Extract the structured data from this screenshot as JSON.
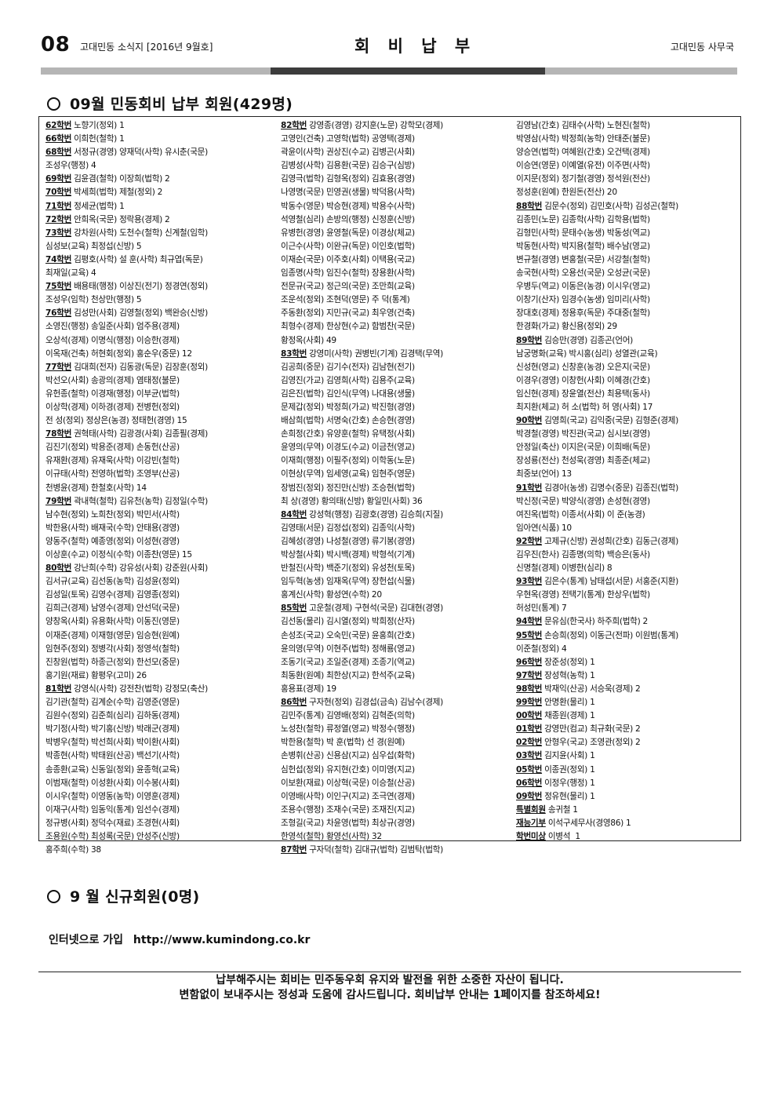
{
  "header": {
    "page_number": "08",
    "issue": "고대민동 소식지 [2016년  9월호]",
    "title": "회 비 납 부",
    "org": "고대민동 사무국"
  },
  "section1": {
    "title": "09월 민동회비 납부 회원(429명)"
  },
  "columns": [
    [
      {
        "lead": "62학번",
        "text": " 노향기(정외) 1"
      },
      {
        "lead": "66학번",
        "text": " 이희헌(철학) 1"
      },
      {
        "lead": "68학번",
        "text": " 서정규(경영) 양재덕(사학) 유시춘(국문)"
      },
      {
        "lead": "",
        "text": "조성우(행정) 4"
      },
      {
        "lead": "69학번",
        "text": " 김윤겸(철학) 이장희(법학) 2"
      },
      {
        "lead": "70학번",
        "text": " 박세희(법학) 제철(정외) 2"
      },
      {
        "lead": "71학번",
        "text": " 정세균(법학) 1"
      },
      {
        "lead": "72학번",
        "text": " 안희옥(국문) 정락용(경제) 2"
      },
      {
        "lead": "73학번",
        "text": " 강차원(사학) 도천수(철학) 신계철(임학)"
      },
      {
        "lead": "",
        "text": "심성보(교육) 최정섭(신방) 5"
      },
      {
        "lead": "74학번",
        "text": " 김평호(사학) 설 훈(사학) 최규엽(독문)"
      },
      {
        "lead": "",
        "text": "최재일(교육) 4"
      },
      {
        "lead": "75학번",
        "text": " 배용태(행정) 이상진(전기) 정경연(정외)"
      },
      {
        "lead": "",
        "text": "조성우(임학) 천상만(행정) 5"
      },
      {
        "lead": "76학번",
        "text": " 김성만(사회) 김영철(정외) 백완승(신방)"
      },
      {
        "lead": "",
        "text": "소영진(행정) 송일준(사회) 엄주용(경제)"
      },
      {
        "lead": "",
        "text": "오상석(경제) 이명식(행정) 이승한(경제)"
      },
      {
        "lead": "",
        "text": "이옥재(건축) 허현회(정외) 홍순우(중문) 12"
      },
      {
        "lead": "77학번",
        "text": " 김대희(전자) 김동광(독문) 김장훈(정외)"
      },
      {
        "lead": "",
        "text": "박선오(사회) 송광의(경제) 염태정(불문)"
      },
      {
        "lead": "",
        "text": "유헌종(철학) 이경재(행정) 이부균(법학)"
      },
      {
        "lead": "",
        "text": "이상학(경제) 이하경(경제) 전병헌(정외)"
      },
      {
        "lead": "",
        "text": "전 성(정외) 정상은(농경) 정태헌(경영) 15"
      },
      {
        "lead": "78학번",
        "text": " 권혁태(사학) 김광경(사회) 김종필(경제)"
      },
      {
        "lead": "",
        "text": "김진기(정외) 박용준(경제) 손동헌(산공)"
      },
      {
        "lead": "",
        "text": "유재환(경제) 유재욱(사학) 이강빈(철학)"
      },
      {
        "lead": "",
        "text": "이규태(사학) 전영하(법학) 조영부(산공)"
      },
      {
        "lead": "",
        "text": "천병윤(경제) 한철호(사학) 14"
      },
      {
        "lead": "79학번",
        "text": " 곽내혁(철학) 김유천(농학) 김정일(수학)"
      },
      {
        "lead": "",
        "text": "남수현(정외) 노희찬(정외) 박민서(사학)"
      },
      {
        "lead": "",
        "text": "박한용(사학) 배재국(수학) 안태용(경영)"
      },
      {
        "lead": "",
        "text": "양동주(철학) 예종영(정외) 이성현(경영)"
      },
      {
        "lead": "",
        "text": "이상훈(수교) 이정식(수학) 이종찬(영문) 15"
      },
      {
        "lead": "80학번",
        "text": " 강난희(수학) 강유성(사회) 강준원(사회)"
      },
      {
        "lead": "",
        "text": "김서규(교육) 김선동(농학) 김성윤(정외)"
      },
      {
        "lead": "",
        "text": "김성일(토목) 김영수(경제) 김영종(정외)"
      },
      {
        "lead": "",
        "text": "김희근(경제) 남영수(경제) 안선덕(국문)"
      },
      {
        "lead": "",
        "text": "양창옥(사회) 유용화(사학) 이동진(영문)"
      },
      {
        "lead": "",
        "text": "이재준(경제) 이재형(영문) 임승현(원예)"
      },
      {
        "lead": "",
        "text": "임현주(정외) 정병각(사회) 정영석(철학)"
      },
      {
        "lead": "",
        "text": "진창원(법학) 하종근(정외) 한선모(중문)"
      },
      {
        "lead": "",
        "text": "홍기원(재료) 황평우(고미) 26"
      },
      {
        "lead": "81학번",
        "text": " 강영식(사학) 강전찬(법학) 강정모(축산)"
      },
      {
        "lead": "",
        "text": "김기관(철학) 김계순(수학) 김영준(영문)"
      },
      {
        "lead": "",
        "text": "김원수(정외) 김준희(심리) 김하동(경제)"
      },
      {
        "lead": "",
        "text": "박기정(사학) 박기홍(신방) 박래군(경제)"
      },
      {
        "lead": "",
        "text": "박병우(철학) 박선희(사회) 박이환(사회)"
      },
      {
        "lead": "",
        "text": "박종현(사학) 박태원(산공) 백선기(사학)"
      },
      {
        "lead": "",
        "text": "송종환(교육) 신동일(정외) 윤종혁(교육)"
      },
      {
        "lead": "",
        "text": "이범재(철학) 이성환(사회) 이수봉(사회)"
      },
      {
        "lead": "",
        "text": "이시우(철학) 이영동(농학) 이영훈(경제)"
      },
      {
        "lead": "",
        "text": "이재구(사학) 임동익(통계) 임선수(경제)"
      },
      {
        "lead": "",
        "text": "정규병(사회) 정덕수(재료) 조경현(사회)"
      },
      {
        "lead": "",
        "text": "조용원(수학) 최성록(국문) 안성주(신방)"
      },
      {
        "lead": "",
        "text": "홍주희(수학) 38"
      }
    ],
    [
      {
        "lead": "82학번",
        "text": " 강영종(경영) 강지훈(노문) 강학모(경제)"
      },
      {
        "lead": "",
        "text": "고영인(건축) 고영학(법학) 공영택(경제)"
      },
      {
        "lead": "",
        "text": "곽윤이(사학) 권상진(수교) 김병곤(사회)"
      },
      {
        "lead": "",
        "text": "김병성(사학) 김용환(국문) 김승구(심방)"
      },
      {
        "lead": "",
        "text": "김영극(법학) 김형옥(정외) 김효용(경영)"
      },
      {
        "lead": "",
        "text": "나영명(국문) 민영권(생물) 박덕용(사학)"
      },
      {
        "lead": "",
        "text": "박동수(영문) 박승현(경제) 박용수(사학)"
      },
      {
        "lead": "",
        "text": "석영철(심리) 손방의(행정) 신정훈(신방)"
      },
      {
        "lead": "",
        "text": "유병헌(경영) 윤영철(독문) 이경상(체교)"
      },
      {
        "lead": "",
        "text": "이근수(사학) 이완규(독문) 이인호(법학)"
      },
      {
        "lead": "",
        "text": "이재순(국문) 이주호(사회) 이택용(국교)"
      },
      {
        "lead": "",
        "text": "임종명(사학) 임진수(철학) 장용환(사학)"
      },
      {
        "lead": "",
        "text": "전문규(국교) 정근의(국문) 조만희(교육)"
      },
      {
        "lead": "",
        "text": "조운석(정외) 조현덕(영문) 주 덕(통계)"
      },
      {
        "lead": "",
        "text": "주동환(정외) 지민규(국교) 최우영(건축)"
      },
      {
        "lead": "",
        "text": "최형수(경제) 한상현(수교) 함범찬(국문)"
      },
      {
        "lead": "",
        "text": "황정옥(사회) 49"
      },
      {
        "lead": "83학번",
        "text": " 강영미(사학) 권병빈(기계) 김경택(무역)"
      },
      {
        "lead": "",
        "text": "김공희(중문) 김기수(전자) 김남현(전기)"
      },
      {
        "lead": "",
        "text": "김영진(가교) 김영희(사학) 김용주(교육)"
      },
      {
        "lead": "",
        "text": "김은진(법학) 김인식(무역) 나대용(생물)"
      },
      {
        "lead": "",
        "text": "문제갑(정외) 박정희(가교) 박진형(경영)"
      },
      {
        "lead": "",
        "text": "배삼희(법학) 서명숙(간호) 손승현(경영)"
      },
      {
        "lead": "",
        "text": "손희정(간호) 유양훈(철학) 유택정(사회)"
      },
      {
        "lead": "",
        "text": "윤영의(무역) 이경도(수교) 이금천(영교)"
      },
      {
        "lead": "",
        "text": "이재희(행정) 이필주(정외) 이학동(노문)"
      },
      {
        "lead": "",
        "text": "이현상(무역) 임세영(교육) 임현주(영문)"
      },
      {
        "lead": "",
        "text": "장범진(정외) 정진만(신방) 조승현(법학)"
      },
      {
        "lead": "",
        "text": "최 상(경영) 황의태(신방) 황일민(사회) 36"
      },
      {
        "lead": "84학번",
        "text": " 강성혁(행정) 김광호(경영) 김승희(지질)"
      },
      {
        "lead": "",
        "text": "김영태(서문) 김정섭(정외) 김종익(사학)"
      },
      {
        "lead": "",
        "text": "김혜성(경영) 나성철(경영) 류기봉(경영)"
      },
      {
        "lead": "",
        "text": "박상철(사회) 박시백(경제) 박형석(기계)"
      },
      {
        "lead": "",
        "text": "반철진(사학) 백준기(정외) 유성천(토목)"
      },
      {
        "lead": "",
        "text": "임두혁(농생) 임재옥(무역) 장헌섭(식물)"
      },
      {
        "lead": "",
        "text": "홍계신(사학) 황성연(수학) 20"
      },
      {
        "lead": "85학번",
        "text": " 고운철(경제) 구현석(국문) 김대현(경영)"
      },
      {
        "lead": "",
        "text": "김선동(물리) 김시열(정외) 박희정(산자)"
      },
      {
        "lead": "",
        "text": "손성조(국교) 오숙민(국문) 윤홍희(간호)"
      },
      {
        "lead": "",
        "text": "윤의영(무역) 이현주(법학) 정해룡(영교)"
      },
      {
        "lead": "",
        "text": "조동기(국교) 조일준(경제) 조종기(역교)"
      },
      {
        "lead": "",
        "text": "최동환(원예) 최한상(지교) 한석주(교육)"
      },
      {
        "lead": "",
        "text": "홍용표(경제) 19"
      },
      {
        "lead": "86학번",
        "text": " 구자현(정외) 김경섭(금속) 김남수(경제)"
      },
      {
        "lead": "",
        "text": "김민주(통계) 김영배(정외) 김혁준(의학)"
      },
      {
        "lead": "",
        "text": "노성찬(철학) 류정열(영교) 박정수(행정)"
      },
      {
        "lead": "",
        "text": "박한용(철학) 박 훈(법학) 선 경(원예)"
      },
      {
        "lead": "",
        "text": "손병휘(산공) 신용삼(지교) 심우섭(화학)"
      },
      {
        "lead": "",
        "text": "심헌섭(정외) 유지현(간호) 이미영(지교)"
      },
      {
        "lead": "",
        "text": "이보환(재료) 이상혁(국문) 이승철(산공)"
      },
      {
        "lead": "",
        "text": "이영배(사학) 이인구(지교) 조극연(경제)"
      },
      {
        "lead": "",
        "text": "조용수(행정) 조재수(국문) 조재진(지교)"
      },
      {
        "lead": "",
        "text": "조형길(국교) 차윤영(법학) 최상규(경영)"
      },
      {
        "lead": "",
        "text": "한영석(철학) 황영선(사학) 32"
      },
      {
        "lead": "87학번",
        "text": " 구자덕(철학) 김대규(법학) 김범탁(법학)"
      }
    ],
    [
      {
        "lead": "",
        "text": "김영남(간호) 김태수(사학) 노현진(철학)"
      },
      {
        "lead": "",
        "text": "박영삼(사학) 박정희(농학) 안태준(불문)"
      },
      {
        "lead": "",
        "text": "양승연(법학) 여혜원(간호) 오건택(경제)"
      },
      {
        "lead": "",
        "text": "이승연(영문) 이예열(유전) 이주면(사학)"
      },
      {
        "lead": "",
        "text": "이지문(정외) 정기철(경영) 정석원(전산)"
      },
      {
        "lead": "",
        "text": "정성훈(원예) 한원돈(전산) 20"
      },
      {
        "lead": "88학번",
        "text": " 김문수(정외) 김민호(사학) 김성곤(철학)"
      },
      {
        "lead": "",
        "text": "김종민(노문) 김종학(사학) 김학용(법학)"
      },
      {
        "lead": "",
        "text": "김형민(사학) 문태수(농생) 박동성(역교)"
      },
      {
        "lead": "",
        "text": "박동현(사학) 박지용(철학) 배수남(영교)"
      },
      {
        "lead": "",
        "text": "변규철(경영) 변홍철(국문) 서강철(철학)"
      },
      {
        "lead": "",
        "text": "송국현(사학) 오용선(국문) 오성균(국문)"
      },
      {
        "lead": "",
        "text": "우병두(역교) 이동은(농경) 이시우(영교)"
      },
      {
        "lead": "",
        "text": "이창기(산자) 임경수(농생) 임미리(사학)"
      },
      {
        "lead": "",
        "text": "장대호(경제) 정용후(독문) 주대중(철학)"
      },
      {
        "lead": "",
        "text": "한경화(가교) 황신용(정외) 29"
      },
      {
        "lead": "89학번",
        "text": " 김승만(경영) 김종곤(언어)"
      },
      {
        "lead": "",
        "text": "남궁명화(교육) 박시홍(심리) 성열관(교육)"
      },
      {
        "lead": "",
        "text": "신성현(영교) 신창훈(농경) 오은지(국문)"
      },
      {
        "lead": "",
        "text": "이경우(경영) 이창헌(사회) 이혜경(간호)"
      },
      {
        "lead": "",
        "text": "임신현(경제) 장윤열(전산) 최용택(동사)"
      },
      {
        "lead": "",
        "text": "최지환(체교) 허 소(법학) 허 영(사회) 17"
      },
      {
        "lead": "90학번",
        "text": " 김영희(국교) 김익중(국문) 김형준(경제)"
      },
      {
        "lead": "",
        "text": "박경철(경영) 박진관(국교) 심시보(경영)"
      },
      {
        "lead": "",
        "text": "안정일(축산) 이지은(국문) 이희배(독문)"
      },
      {
        "lead": "",
        "text": "장성룡(전산) 천성욱(경영) 최종준(체교)"
      },
      {
        "lead": "",
        "text": "최중보(언어) 13"
      },
      {
        "lead": "91학번",
        "text": " 김경아(농생) 김명수(중문) 김종진(법학)"
      },
      {
        "lead": "",
        "text": "박신정(국문) 박양식(경영) 손성현(경영)"
      },
      {
        "lead": "",
        "text": "여진옥(법학) 이종서(사회) 이 준(농경)"
      },
      {
        "lead": "",
        "text": "임아연(식품) 10"
      },
      {
        "lead": "92학번",
        "text": " 고제규(신방) 권성희(간호) 김동근(경제)"
      },
      {
        "lead": "",
        "text": "김우진(한사) 김종명(의학) 백승은(동사)"
      },
      {
        "lead": "",
        "text": "신명철(경제) 이병한(심리) 8"
      },
      {
        "lead": "93학번",
        "text": " 김은수(통계) 남태섭(서문) 서홍준(지환)"
      },
      {
        "lead": "",
        "text": "우현옥(경영) 전택기(통계) 한상우(법학)"
      },
      {
        "lead": "",
        "text": "허성민(통계) 7"
      },
      {
        "lead": "94학번",
        "text": " 문유심(한국사) 하주희(법학) 2"
      },
      {
        "lead": "95학번",
        "text": " 손승희(정외) 이동근(전파) 이원범(통계)"
      },
      {
        "lead": "",
        "text": "이준철(정외) 4"
      },
      {
        "lead": "96학번",
        "text": " 장준성(정외) 1"
      },
      {
        "lead": "97학번",
        "text": " 장성혁(농학) 1"
      },
      {
        "lead": "98학번",
        "text": " 박재익(산공) 서승욱(경제) 2"
      },
      {
        "lead": "99학번",
        "text": " 안명환(물리) 1"
      },
      {
        "lead": "00학번",
        "text": " 채종원(경제) 1"
      },
      {
        "lead": "01학번",
        "text": " 강영만(컴교) 최규화(국문) 2"
      },
      {
        "lead": "02학번",
        "text": " 안형우(국교) 조영관(정외) 2"
      },
      {
        "lead": "03학번",
        "text": " 김지윤(사회) 1"
      },
      {
        "lead": "05학번",
        "text": " 이종권(정외) 1"
      },
      {
        "lead": "06학번",
        "text": " 이정우(행정) 1"
      },
      {
        "lead": "09학번",
        "text": " 정유현(물리) 1"
      },
      {
        "lead": "특별회원",
        "text": " 송귀철 1"
      },
      {
        "lead": "재능기부",
        "text": " 이석구세무사(경영86) 1"
      },
      {
        "lead": "학번미상",
        "text": " 이병석  1"
      }
    ]
  ],
  "section2": {
    "title": "9 월 신규회원(0명)"
  },
  "join": {
    "label": "인터넷으로 가입",
    "url": "http://www.kumindong.co.kr"
  },
  "notice": {
    "line1": "납부해주시는 회비는 민주동우회 유지와 발전을 위한 소중한 자산이 됩니다.",
    "line2": "변함없이 보내주시는 정성과 도움에 감사드립니다. 회비납부 안내는 1페이지를 참조하세요!"
  }
}
